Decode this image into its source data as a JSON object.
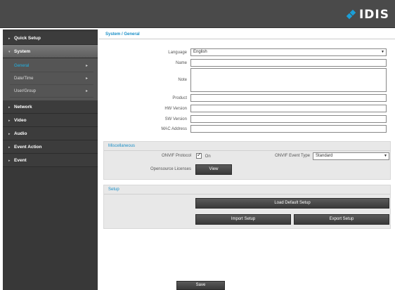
{
  "header": {
    "logo_text": "IDIS"
  },
  "sidebar": {
    "items": [
      {
        "label": "Quick Setup"
      },
      {
        "label": "System"
      },
      {
        "label": "Network"
      },
      {
        "label": "Video"
      },
      {
        "label": "Audio"
      },
      {
        "label": "Event Action"
      },
      {
        "label": "Event"
      }
    ],
    "system_sub": [
      {
        "label": "General"
      },
      {
        "label": "Date/Time"
      },
      {
        "label": "User/Group"
      }
    ]
  },
  "main": {
    "breadcrumb": "System / General",
    "form": {
      "language_label": "Language",
      "language_value": "English",
      "name_label": "Name",
      "name_value": "",
      "note_label": "Note",
      "note_value": "",
      "product_label": "Product",
      "product_value": "",
      "hw_label": "HW Version",
      "hw_value": "",
      "sw_label": "SW Version",
      "sw_value": "",
      "mac_label": "MAC Address",
      "mac_value": ""
    },
    "misc": {
      "title": "Miscellaneous",
      "onvif_label": "ONVIF Protocol",
      "onvif_on": "On",
      "onvif_event_label": "ONVIF Event Type",
      "onvif_event_value": "Standard",
      "oss_label": "Opensource Licenses",
      "view_btn": "View"
    },
    "setup": {
      "title": "Setup",
      "load_default": "Load Default Setup",
      "import": "Import Setup",
      "export": "Export Setup"
    },
    "save_btn": "Save"
  },
  "colors": {
    "accent": "#1a8fc8",
    "topbar": "#4a4a4a",
    "sidebar": "#383838"
  }
}
